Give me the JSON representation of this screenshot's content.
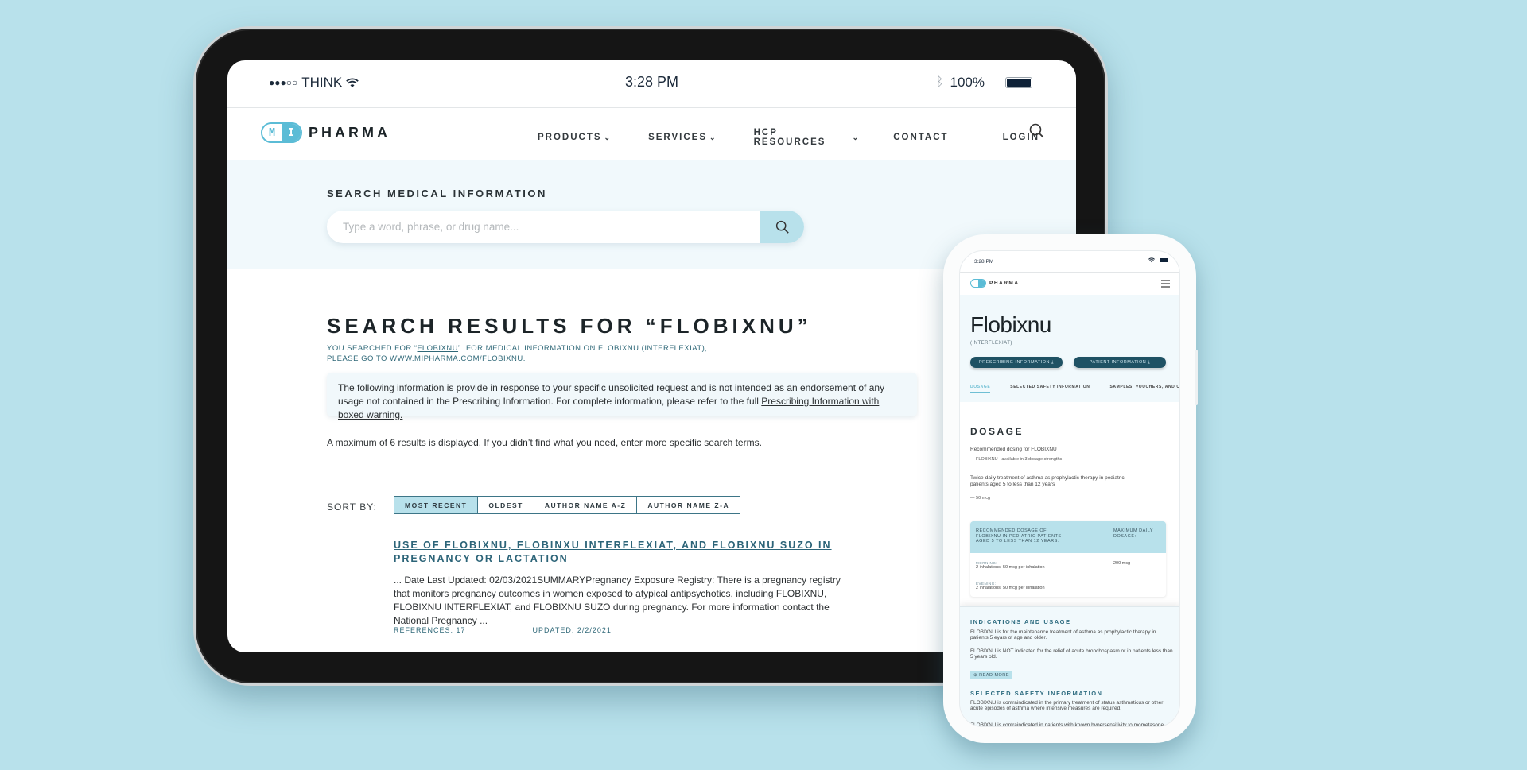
{
  "tablet": {
    "status": {
      "signal_dots": "●●●○○",
      "carrier": "THINK",
      "time": "3:28 PM",
      "battery": "100%"
    },
    "nav": {
      "logo_m": "M",
      "logo_i": "I",
      "logo_text": "PHARMA",
      "items": [
        {
          "label": "PRODUCTS",
          "dropdown": true
        },
        {
          "label": "SERVICES",
          "dropdown": true
        },
        {
          "label": "HCP RESOURCES",
          "dropdown": true
        },
        {
          "label": "CONTACT",
          "dropdown": false
        },
        {
          "label": "LOGIN",
          "dropdown": false
        }
      ],
      "search_icon": "search-icon"
    },
    "search": {
      "label": "SEARCH MEDICAL INFORMATION",
      "placeholder": "Type a word, phrase, or drug name...",
      "value": ""
    },
    "results": {
      "title": "SEARCH RESULTS FOR “FLOBIXNU”",
      "sub_prefix": "YOU SEARCHED FOR “",
      "sub_term": "FLOBIXNU",
      "sub_mid": "”. FOR MEDICAL INFORMATION ON FLOBIXNU (INTERFLEXIAT),",
      "sub_line2_prefix": "PLEASE GO TO ",
      "sub_link": "WWW.MIPHARMA.COM/FLOBIXNU",
      "sub_line2_suffix": ".",
      "notice_text": "The following information is provide in response to your specific unsolicited request and is not intended as an endorsement of any usage not contained in the Prescribing Information. For complete information, please refer to the full ",
      "notice_link": "Prescribing Information with boxed warning.",
      "max_note": "A maximum of 6 results is displayed. If you didn’t find what you need, enter more specific search terms.",
      "sort_label": "SORT BY:",
      "sort_options": [
        {
          "label": "MOST RECENT",
          "active": true
        },
        {
          "label": "OLDEST",
          "active": false
        },
        {
          "label": "AUTHOR NAME A-Z",
          "active": false
        },
        {
          "label": "AUTHOR NAME Z-A",
          "active": false
        }
      ],
      "items": [
        {
          "title": "USE OF FLOBIXNU, FLOBINXU INTERFLEXIAT, AND FLOBIXNU SUZO IN PREGNANCY OR LACTATION",
          "snippet": "... Date Last Updated: 02/03/2021SUMMARYPregnancy Exposure Registry: There is a pregnancy registry that monitors pregnancy outcomes in women exposed to atypical antipsychotics, including FLOBIXNU, FLOBIXNU INTERFLEXIAT, and FLOBIXNU SUZO during pregnancy. For more information contact the National Pregnancy ...",
          "references": "REFERENCES: 17",
          "updated": "UPDATED: 2/2/2021"
        }
      ]
    }
  },
  "phone": {
    "status": {
      "time": "3:28 PM"
    },
    "nav": {
      "logo_text": "PHARMA"
    },
    "hero": {
      "title": "Flobixnu",
      "subtitle": "(INTERFLEXIAT)",
      "buttons": [
        "PRESCRIBING INFORMATION ⤓",
        "PATIENT INFORMATION ⤓"
      ],
      "tabs": [
        {
          "label": "DOSAGE",
          "active": true
        },
        {
          "label": "SELECTED SAFETY INFORMATION",
          "active": false
        },
        {
          "label": "SAMPLES, VOUCHERS, AND C",
          "active": false
        }
      ]
    },
    "dosage": {
      "heading": "DOSAGE",
      "line1": "Recommended dosing for FLOBIXNU",
      "line2": "FLOBIXNU - available in 3 dosage strengths",
      "line3": "Twice-daily treatment of asthma as prophylactic therapy in pediatric patients aged 5 to less than 12 years",
      "line4": "50 mcg",
      "table": {
        "col1": "RECOMMENDED DOSAGE OF FLOBIXNU IN PEDIATRIC PATIENTS AGED 5 TO LESS THAN 12 YEARS:",
        "col2": "MAXIMUM DAILY DOSAGE:",
        "rows": [
          {
            "label": "MORNING:",
            "value": "2 inhalations; 50 mcg per inhalation",
            "max": "200 mcg"
          },
          {
            "label": "EVENING:",
            "value": "2 inhalations; 50 mcg per inhalation",
            "max": ""
          }
        ]
      }
    },
    "panel": {
      "indications_heading": "INDICATIONS AND USAGE",
      "indications_p1": "FLOBIXNU is for the maintenance treatment of asthma as prophylactic therapy in patients 5 eyars of age and older.",
      "indications_p2": "FLOBIXNU is NOT indicated for the relief of acute bronchospasm or in patients less than 5 years old.",
      "read_more": "⊕ READ MORE",
      "safety_heading": "SELECTED SAFETY INFORMATION",
      "safety_p1": "FLOBIXNU is contraindicated in the primary treatment of status asthmaticus or other acute episodes of asthma where intensive measures are required.",
      "safety_p2": "FLOBIXNU is contraindicated in patients with known hypersensitivity to mometasone."
    }
  },
  "colors": {
    "background": "#b8e1eb",
    "accent": "#5bbcd6",
    "link": "#2c6478",
    "dark_button": "#1f5264",
    "light_band": "#f1f9fc"
  }
}
